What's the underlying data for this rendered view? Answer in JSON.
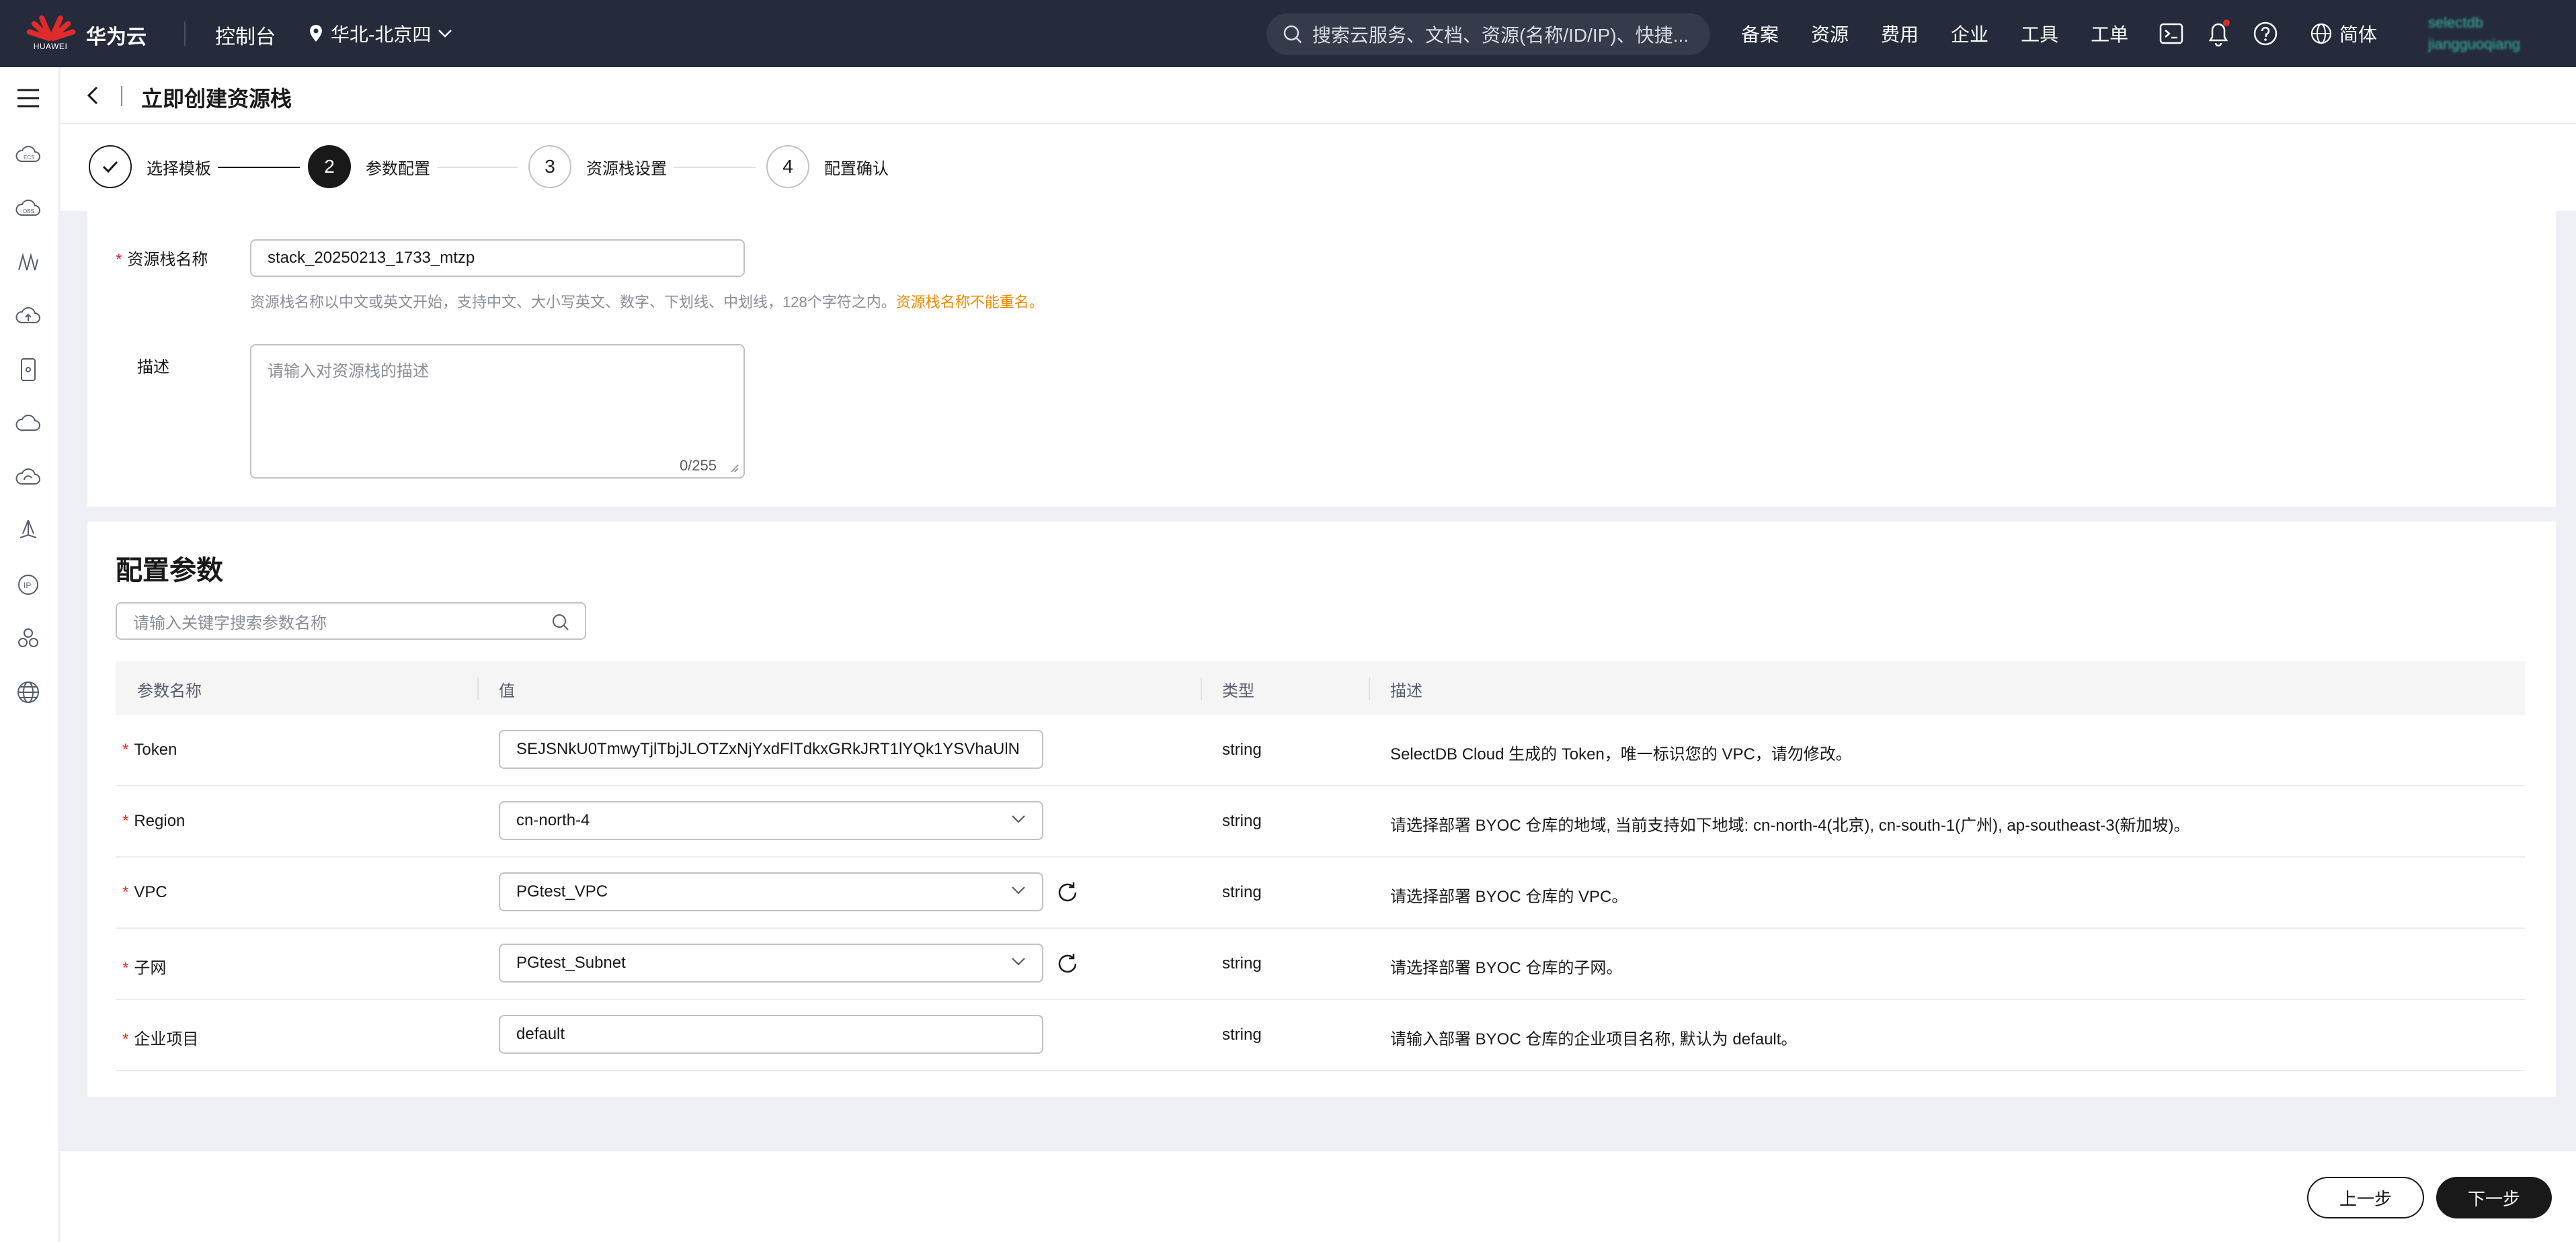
{
  "topbar": {
    "logo_word": "HUAWEI",
    "brand": "华为云",
    "console": "控制台",
    "region": "华北-北京四",
    "search_placeholder": "搜索云服务、文档、资源(名称/ID/IP)、快捷...",
    "links": [
      "备案",
      "资源",
      "费用",
      "企业",
      "工具",
      "工单"
    ],
    "lang": "简体",
    "user_line1": "selectdb",
    "user_line2": "jiangguoqiang"
  },
  "header": {
    "title": "立即创建资源栈"
  },
  "steps": [
    {
      "num": "✓",
      "label": "选择模板",
      "state": "done"
    },
    {
      "num": "2",
      "label": "参数配置",
      "state": "active"
    },
    {
      "num": "3",
      "label": "资源栈设置",
      "state": "todo"
    },
    {
      "num": "4",
      "label": "配置确认",
      "state": "todo"
    }
  ],
  "basic": {
    "name_label": "资源栈名称",
    "name_value": "stack_20250213_1733_mtzp",
    "name_hint": "资源栈名称以中文或英文开始，支持中文、大小写英文、数字、下划线、中划线，128个字符之内。",
    "name_warning": "资源栈名称不能重名。",
    "desc_label": "描述",
    "desc_placeholder": "请输入对资源栈的描述",
    "desc_count": "0/255"
  },
  "params": {
    "title": "配置参数",
    "search_placeholder": "请输入关键字搜索参数名称",
    "columns": [
      "参数名称",
      "值",
      "类型",
      "描述"
    ],
    "rows": [
      {
        "name": "Token",
        "value": "SEJSNkU0TmwyTjlTbjJLOTZxNjYxdFlTdkxGRkJRT1lYQk1YSVhaUlN",
        "type": "string",
        "desc": "SelectDB Cloud 生成的 Token，唯一标识您的 VPC，请勿修改。"
      },
      {
        "name": "Region",
        "value": "cn-north-4",
        "type": "string",
        "desc": "请选择部署 BYOC 仓库的地域, 当前支持如下地域: cn-north-4(北京), cn-south-1(广州), ap-southeast-3(新加坡)。"
      },
      {
        "name": "VPC",
        "value": "PGtest_VPC",
        "type": "string",
        "desc": "请选择部署 BYOC 仓库的 VPC。"
      },
      {
        "name": "子网",
        "value": "PGtest_Subnet",
        "type": "string",
        "desc": "请选择部署 BYOC 仓库的子网。"
      },
      {
        "name": "企业项目",
        "value": "default",
        "type": "string",
        "desc": "请输入部署 BYOC 仓库的企业项目名称, 默认为 default。"
      }
    ]
  },
  "footer": {
    "prev": "上一步",
    "next": "下一步"
  },
  "colors": {
    "topbar": "#252b3a",
    "primary": "#191919",
    "required": "#e02b2b",
    "warning": "#f08a00"
  }
}
